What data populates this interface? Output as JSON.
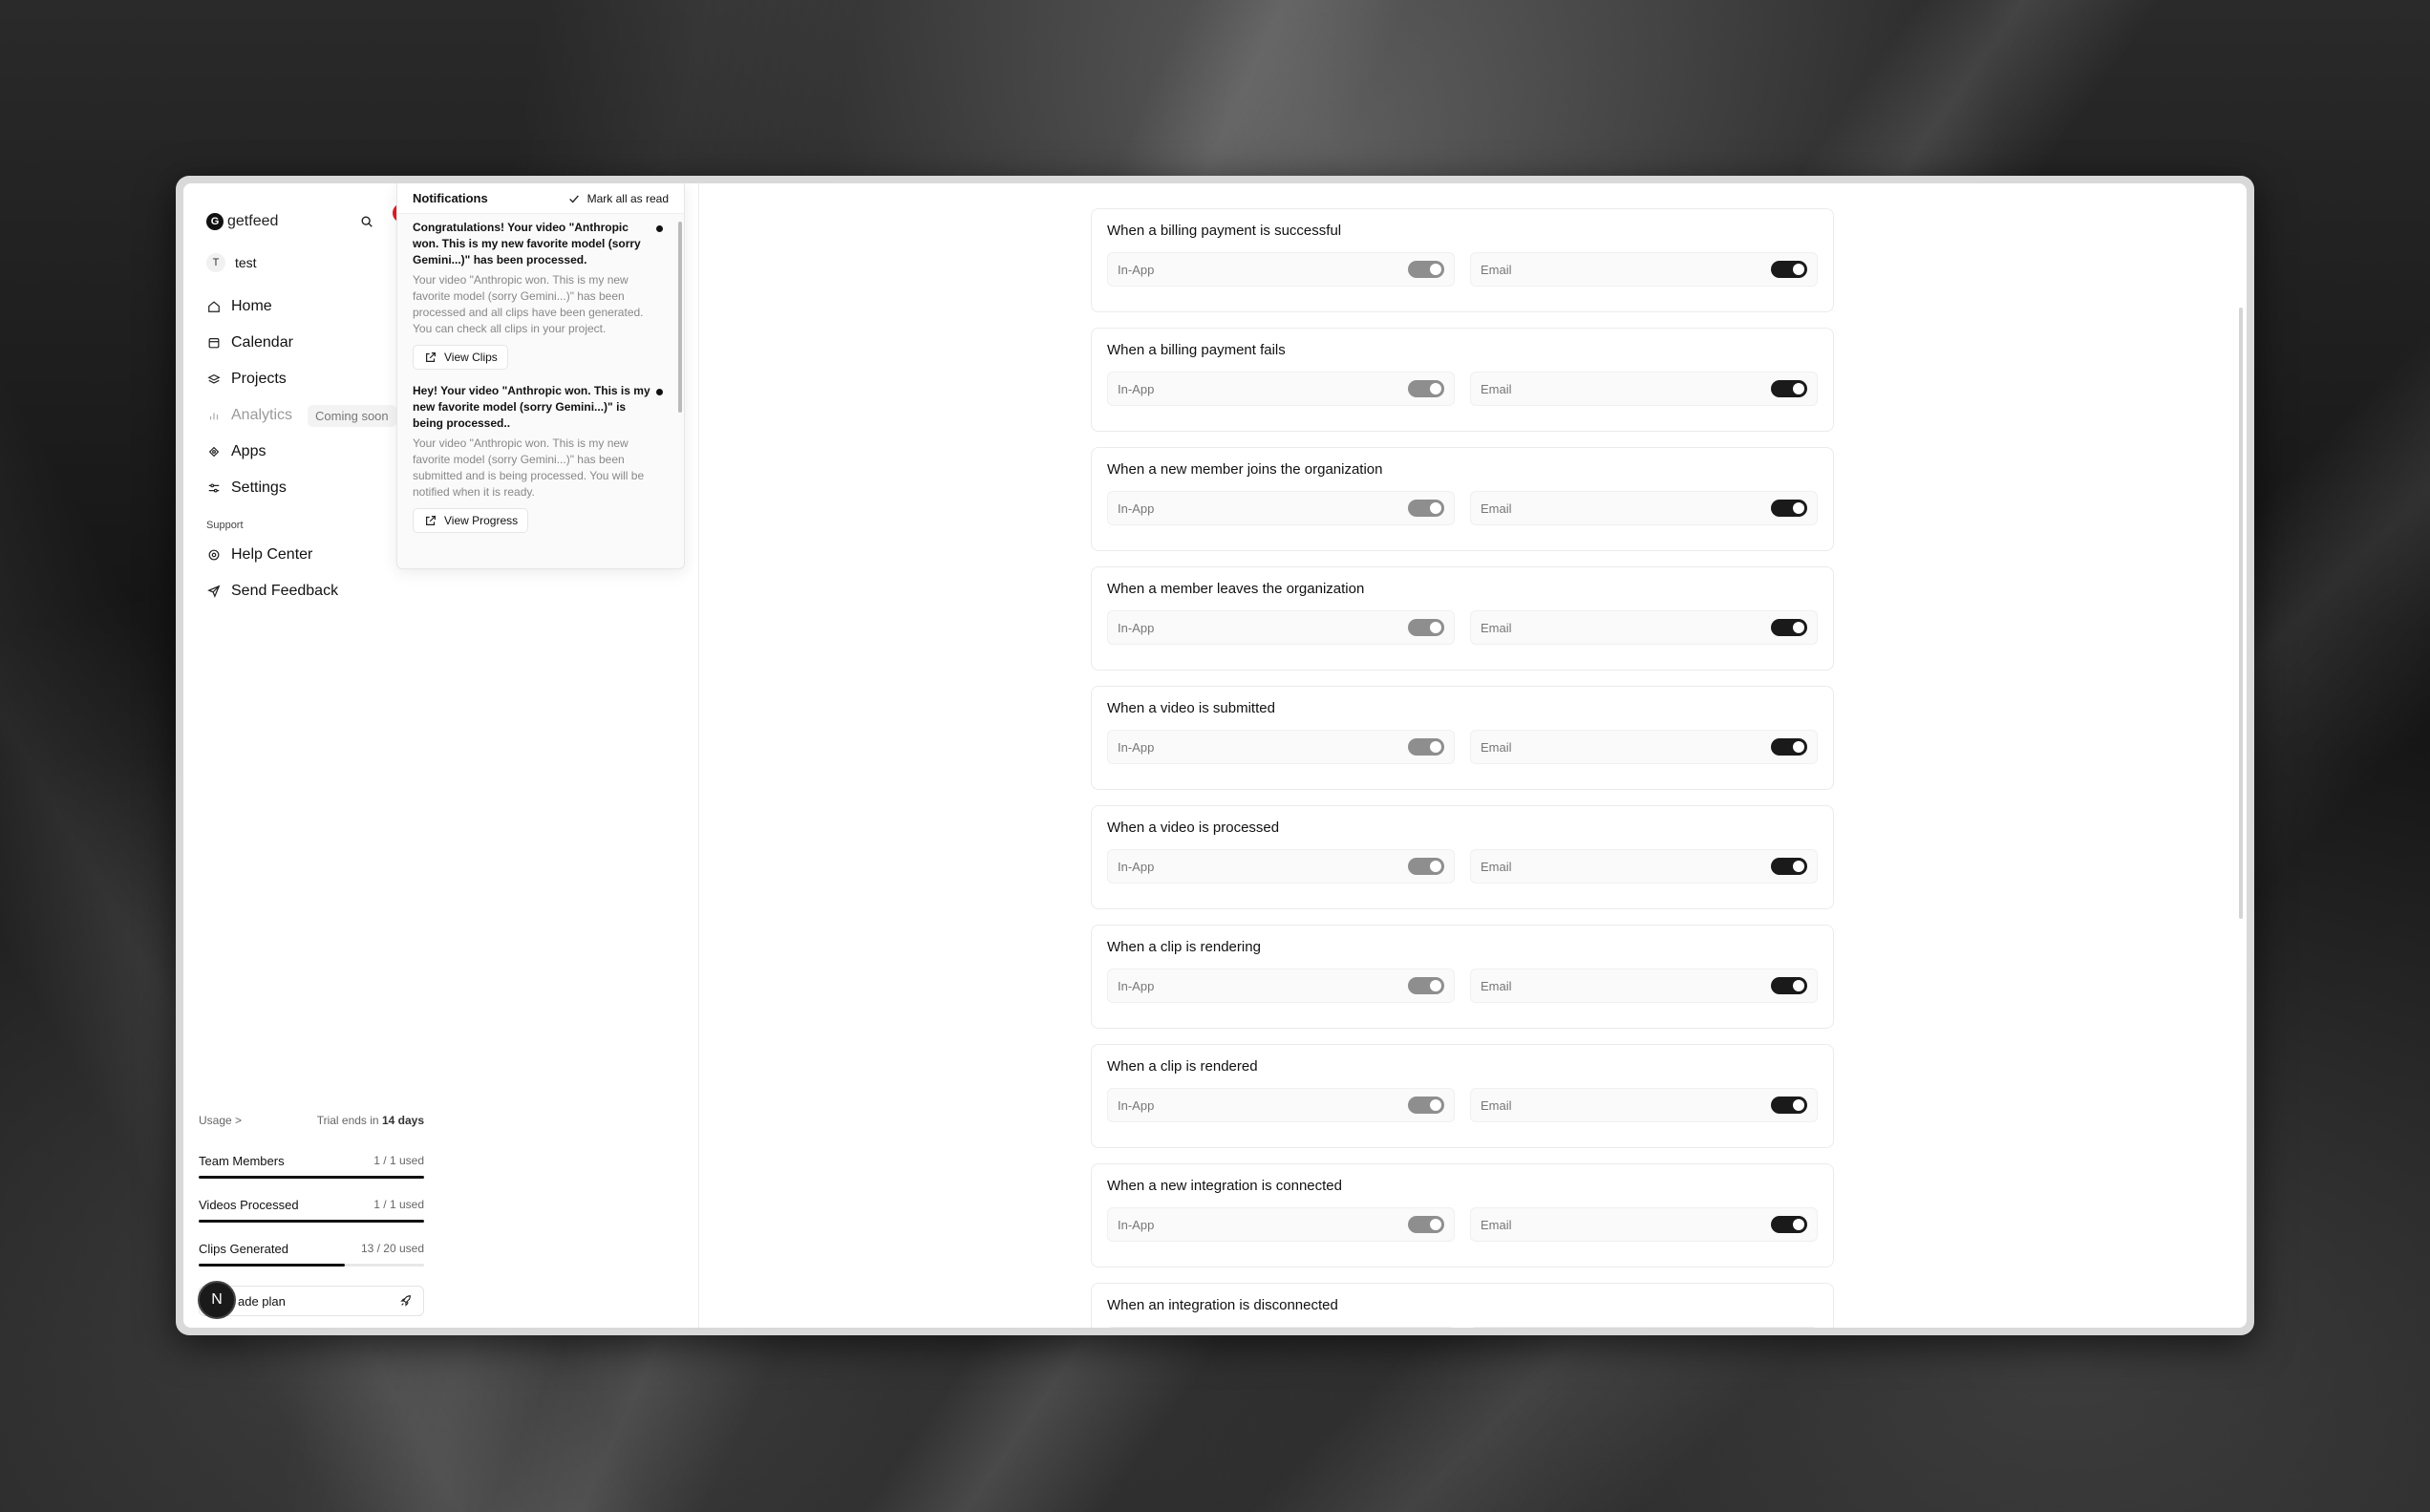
{
  "app": {
    "brand": "getfeed",
    "logo_letter": "G",
    "workspace_initial": "T",
    "workspace_name": "test"
  },
  "nav": [
    {
      "label": "Home",
      "icon": "home-icon"
    },
    {
      "label": "Calendar",
      "icon": "calendar-icon"
    },
    {
      "label": "Projects",
      "icon": "projects-icon"
    },
    {
      "label": "Analytics",
      "icon": "analytics-icon",
      "badge": "Coming soon"
    },
    {
      "label": "Apps",
      "icon": "apps-icon"
    },
    {
      "label": "Settings",
      "icon": "settings-icon"
    }
  ],
  "support": {
    "label": "Support",
    "items": [
      {
        "label": "Help Center",
        "icon": "help-icon"
      },
      {
        "label": "Send Feedback",
        "icon": "send-icon"
      }
    ]
  },
  "usage": {
    "label": "Usage >",
    "trial_prefix": "Trial ends in",
    "trial_days": "14 days",
    "rows": [
      {
        "label": "Team Members",
        "value": "1 / 1 used",
        "fraction": 1.0
      },
      {
        "label": "Videos Processed",
        "value": "1 / 1 used",
        "fraction": 1.0
      },
      {
        "label": "Clips Generated",
        "value": "13 / 20 used",
        "fraction": 0.65
      }
    ],
    "upgrade_label": "ade plan",
    "avatar_letter": "N"
  },
  "notifications": {
    "title": "Notifications",
    "mark_all": "Mark all as read",
    "items": [
      {
        "title": "Congratulations! Your video \"Anthropic won. This is my new favorite model (sorry Gemini...)\" has been processed.",
        "body": "Your video \"Anthropic won. This is my new favorite model (sorry Gemini...)\" has been processed and all clips have been generated. You can check all clips in your project.",
        "action": "View Clips"
      },
      {
        "title": "Hey! Your video \"Anthropic won. This is my new favorite model (sorry Gemini...)\" is being processed..",
        "body": "Your video \"Anthropic won. This is my new favorite model (sorry Gemini...)\" has been submitted and is being processed. You will be notified when it is ready.",
        "action": "View Progress"
      }
    ]
  },
  "settings": {
    "in_app_label": "In-App",
    "email_label": "Email",
    "rows": [
      "When a billing payment is successful",
      "When a billing payment fails",
      "When a new member joins the organization",
      "When a member leaves the organization",
      "When a video is submitted",
      "When a video is processed",
      "When a clip is rendering",
      "When a clip is rendered",
      "When a new integration is connected",
      "When an integration is disconnected"
    ]
  }
}
